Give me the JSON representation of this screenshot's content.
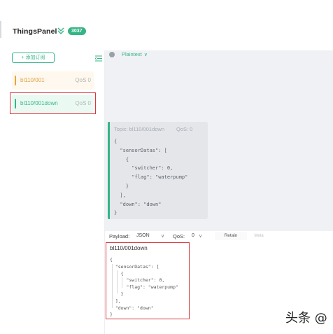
{
  "header": {
    "title": "ThingsPanel",
    "version": "3037"
  },
  "sidebar": {
    "add_button": "+ 添加订阅",
    "connections": [
      {
        "name": "bl110/001",
        "qos": "QoS 0"
      },
      {
        "name": "bl110/001down",
        "qos": "QoS 0"
      }
    ]
  },
  "toolbar": {
    "format": "Plaintext"
  },
  "message": {
    "topic": "Topic: bl110/001down",
    "qos": "QoS: 0",
    "payload": "{\n  \"sensorDatas\": [\n    {\n      \"switcher\": 0,\n      \"flag\": \"waterpump\"\n    }\n  ],\n  \"down\": \"down\"\n}"
  },
  "composer": {
    "payload_label": "Payload:",
    "payload_format": "JSON",
    "qos_label": "QoS:",
    "qos_value": "0",
    "retain_label": "Retain",
    "meta_label": "Meta",
    "topic": "bl110/001down",
    "payload": "{\n  \"sensorDatas\": [\n    {\n      \"switcher\": 0,\n      \"flag\": \"waterpump\"\n    }\n  ],\n  \"down\": \"down\"\n}"
  },
  "watermark": "头条 @",
  "colors": {
    "accent": "#35b586",
    "warning": "#e8a33a",
    "highlight": "#d9363e"
  }
}
